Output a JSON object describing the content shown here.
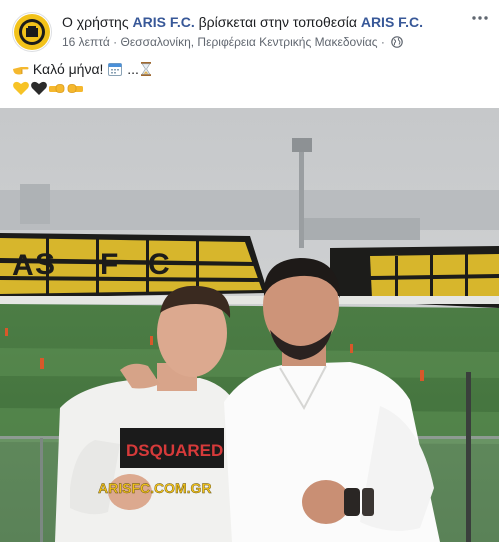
{
  "post": {
    "author_prefix": "Ο χρήστης ",
    "author_name": "ARIS F.C.",
    "mid_text": " βρίσκεται στην τοποθεσία ",
    "location_name": "ARIS F.C.",
    "time": "16 λεπτά",
    "separator": " · ",
    "place": "Θεσσαλονίκη, Περιφέρεια Κεντρικής Μακεδονίας",
    "separator2": " · ",
    "privacy_icon": "globe-icon",
    "message_line1": "Καλό μήνα!",
    "message_ellipsis": "...",
    "emoji_line1": [
      "pointing-hand-icon",
      "calendar-icon",
      "hourglass-icon"
    ],
    "emoji_line2": [
      "yellow-heart-icon",
      "black-heart-icon",
      "left-fist-icon",
      "right-fist-icon"
    ]
  },
  "photo": {
    "stand_letters": [
      "A",
      "S",
      "F",
      "C"
    ],
    "watermark": "ARISFC.COM.GR",
    "shirt_text": "DSQUARED"
  },
  "colors": {
    "link": "#385898",
    "meta": "#616770",
    "club_yellow": "#f2c21a",
    "club_black": "#1b1b1b"
  }
}
